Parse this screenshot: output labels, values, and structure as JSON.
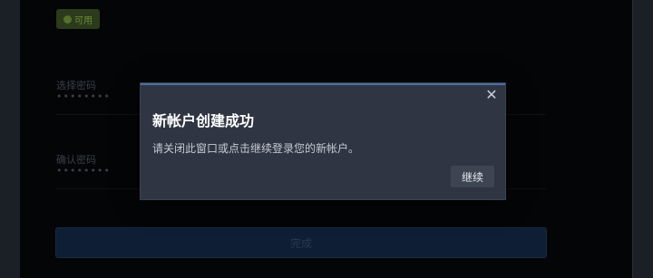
{
  "form": {
    "available_badge": "可用",
    "password_label": "选择密码",
    "password_value": "••••••••",
    "confirm_label": "确认密码",
    "confirm_value": "••••••••",
    "submit_label": "完成"
  },
  "dialog": {
    "title": "新帐户创建成功",
    "message": "请关闭此窗口或点击继续登录您的新帐户。",
    "continue_label": "继续",
    "close_glyph": "✕"
  },
  "colors": {
    "dialog_bg": "#2f3542",
    "accent": "#4a6fa8",
    "submit_bg": "#0e1e35"
  }
}
